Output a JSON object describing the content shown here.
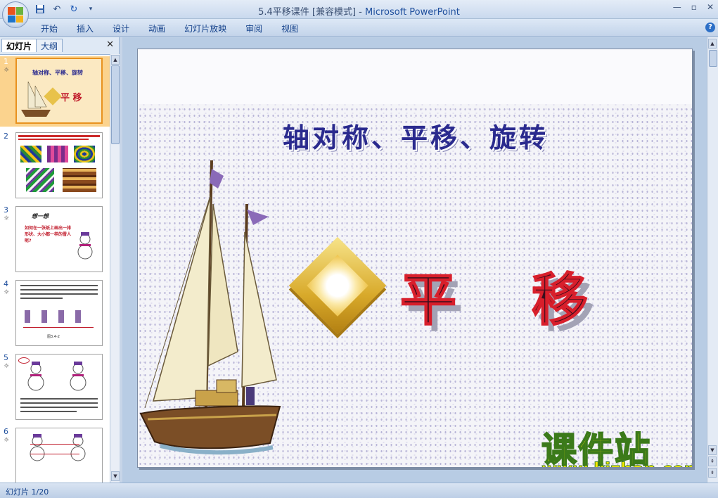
{
  "window": {
    "title_doc": "5.4平移课件 [兼容模式]",
    "title_sep": " - ",
    "title_app": "Microsoft PowerPoint"
  },
  "ribbon": {
    "tabs": [
      "开始",
      "插入",
      "设计",
      "动画",
      "幻灯片放映",
      "审阅",
      "视图"
    ]
  },
  "left_panel": {
    "tabs": [
      "幻灯片",
      "大纲"
    ],
    "close": "✕",
    "slides": [
      {
        "num": "1",
        "mark": "☼",
        "thumb_title": "轴对称、平移、旋转",
        "thumb_text": "平 移"
      },
      {
        "num": "2",
        "mark": "",
        "thumb_title": "",
        "thumb_text": ""
      },
      {
        "num": "3",
        "mark": "☼",
        "thumb_title": "想一想",
        "thumb_text": "如何在一张纸上画出一排形状、大小都一样的雪人呢?"
      },
      {
        "num": "4",
        "mark": "☼",
        "thumb_title": "",
        "thumb_text": "图3.4-2"
      },
      {
        "num": "5",
        "mark": "☼",
        "thumb_title": "",
        "thumb_text": ""
      },
      {
        "num": "6",
        "mark": "☼",
        "thumb_title": "",
        "thumb_text": ""
      }
    ]
  },
  "slide": {
    "title": "轴对称、平移、旋转",
    "char1": "平",
    "char2": "移",
    "watermark_cn": "课件站",
    "watermark_url": "www.kjzhan.com"
  },
  "status": {
    "slide_counter": "幻灯片 1/20"
  },
  "colors": {
    "ribbon_text": "#15428b",
    "title_blue": "#2a2a8e",
    "char_red": "#d81f2b",
    "selected_thumb": "#fbd38e"
  }
}
